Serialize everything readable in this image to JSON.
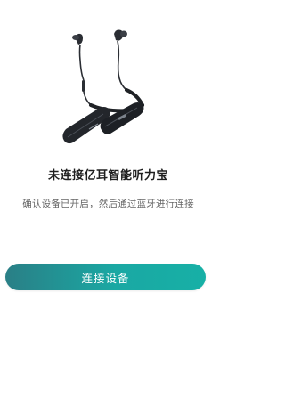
{
  "product": {
    "image_icon": "neckband-earphones-image"
  },
  "main": {
    "title": "未连接亿耳智能听力宝",
    "subtitle": "确认设备已开启，然后通过蓝牙进行连接"
  },
  "actions": {
    "connect_label": "连接设备"
  },
  "colors": {
    "button_start": "#2a7f86",
    "button_end": "#17b0a6",
    "title_text": "#1f1f1f",
    "subtitle_text": "#666666",
    "background": "#ffffff"
  }
}
